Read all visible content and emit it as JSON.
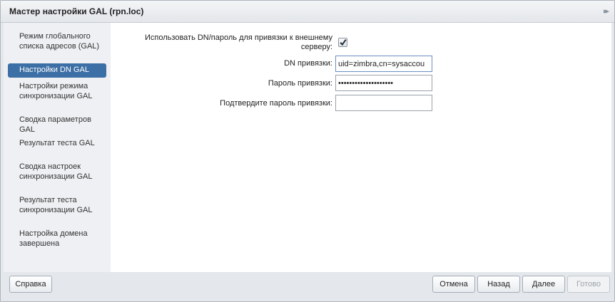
{
  "window": {
    "title": "Мастер настройки GAL (rpn.loc)"
  },
  "sidebar": {
    "items": [
      {
        "label": "Режим глобального списка адресов (GAL)",
        "active": false
      },
      {
        "label": "Настройки DN GAL",
        "active": true
      },
      {
        "label": "Настройки режима синхронизации GAL",
        "active": false
      },
      {
        "label": "Сводка параметров GAL",
        "active": false
      },
      {
        "label": "Результат теста GAL",
        "active": false
      },
      {
        "label": "Сводка настроек синхронизации GAL",
        "active": false
      },
      {
        "label": "Результат теста синхронизации GAL",
        "active": false
      },
      {
        "label": "Настройка домена завершена",
        "active": false
      }
    ]
  },
  "form": {
    "use_dn_label": "Использовать DN/пароль для привязки к внешнему серверу:",
    "use_dn_checked": true,
    "bind_dn_label": "DN привязки:",
    "bind_dn_value": "uid=zimbra,cn=sysaccou",
    "bind_password_label": "Пароль привязки:",
    "bind_password_value": "••••••••••••••••••••",
    "confirm_password_label": "Подтвердите пароль привязки:",
    "confirm_password_value": ""
  },
  "footer": {
    "help_label": "Справка",
    "cancel_label": "Отмена",
    "back_label": "Назад",
    "next_label": "Далее",
    "finish_label": "Готово"
  }
}
